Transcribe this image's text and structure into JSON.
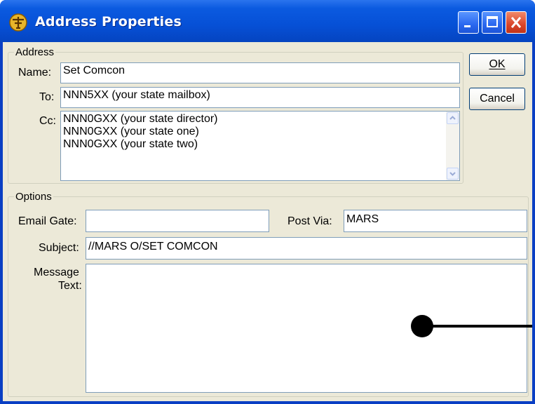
{
  "window": {
    "title": "Address Properties"
  },
  "address_group": {
    "legend": "Address",
    "name_label": "Name:",
    "name_value": "Set Comcon",
    "to_label": "To:",
    "to_value": "NNN5XX (your state mailbox)",
    "cc_label": "Cc:",
    "cc_lines": [
      "NNN0GXX (your state director)",
      "NNN0GXX (your state one)",
      "NNN0GXX (your state two)"
    ]
  },
  "buttons": {
    "ok": "OK",
    "cancel": "Cancel"
  },
  "options_group": {
    "legend": "Options",
    "email_gate_label": "Email Gate:",
    "email_gate_value": "",
    "post_via_label": "Post Via:",
    "post_via_value": "MARS",
    "subject_label": "Subject:",
    "subject_value": "//MARS O/SET COMCON",
    "message_label_line1": "Message",
    "message_label_line2": "Text:",
    "message_value": ""
  },
  "colors": {
    "titlebar": "#0650d6",
    "client": "#ece9d8",
    "close_button": "#d9452a"
  }
}
